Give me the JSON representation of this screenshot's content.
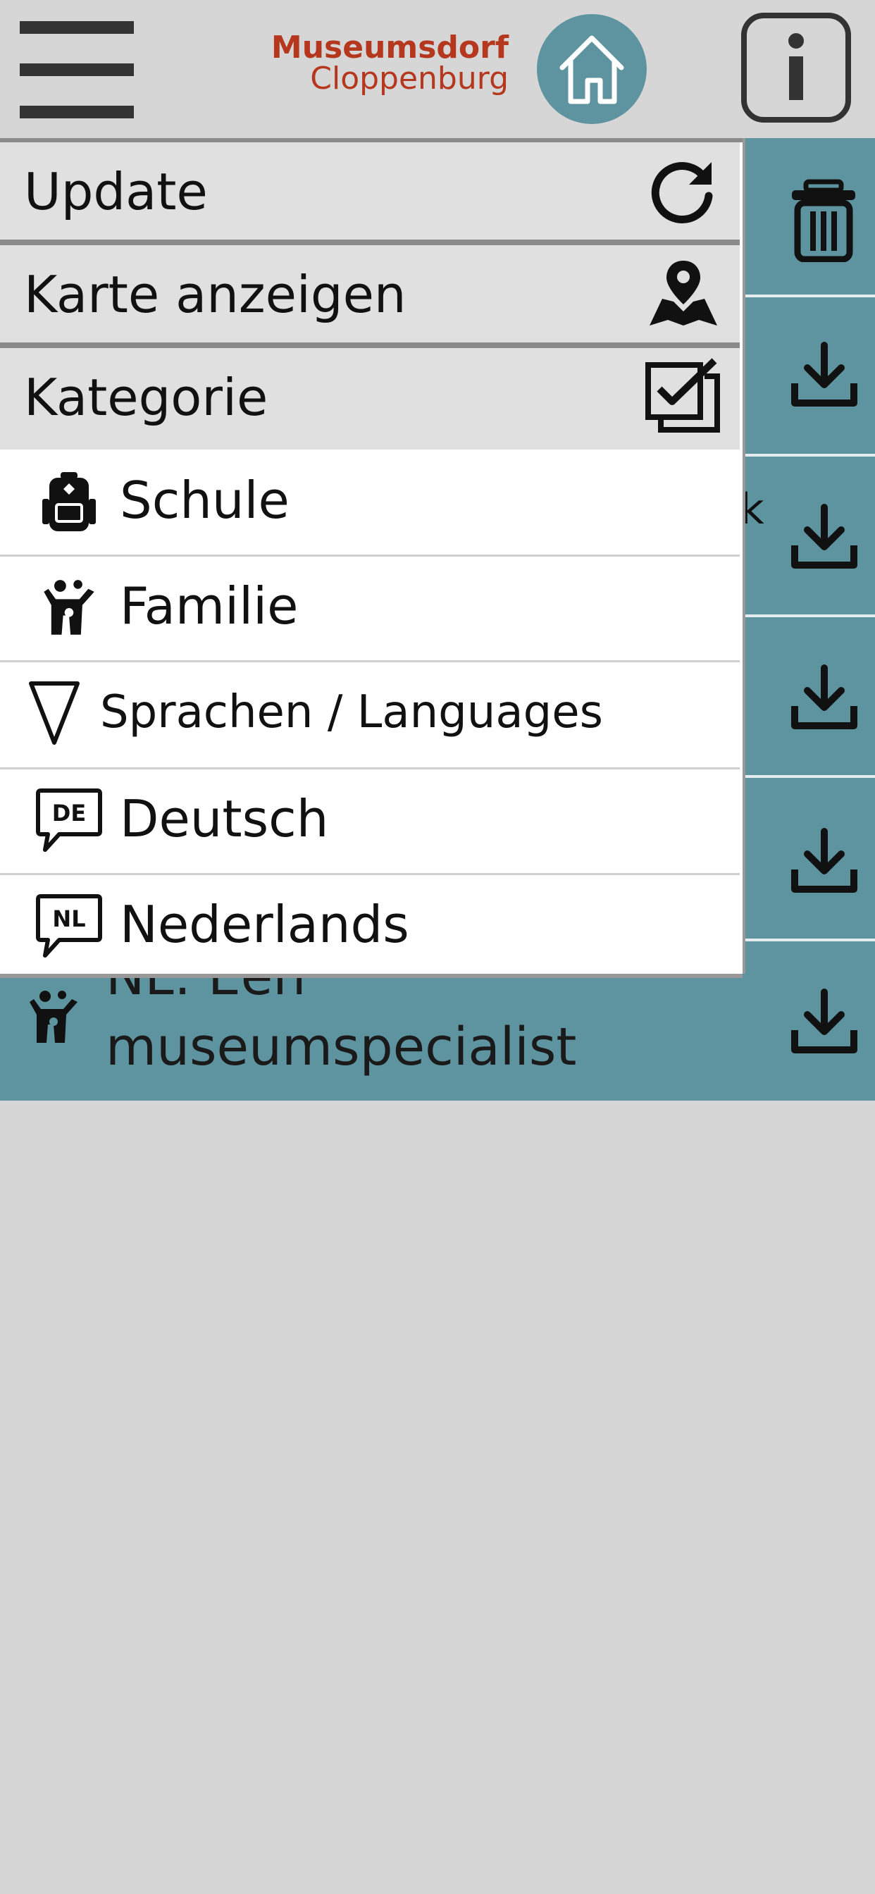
{
  "header": {
    "menu_icon": "hamburger-menu-icon",
    "logo_line1": "Museumsdorf",
    "logo_line2": "Cloppenburg",
    "home_icon": "home-icon",
    "info_icon": "info-icon"
  },
  "menu": {
    "update_label": "Update",
    "update_icon": "refresh-icon",
    "map_label": "Karte anzeigen",
    "map_icon": "map-pin-icon",
    "category_label": "Kategorie",
    "category_icon": "checkbox-icon",
    "items": [
      {
        "label": "Schule",
        "icon": "backpack-icon"
      },
      {
        "label": "Familie",
        "icon": "family-icon"
      },
      {
        "label": "Sprachen / Languages",
        "icon": "triangle-down-icon"
      },
      {
        "label": "Deutsch",
        "icon": "de-speech-bubble-icon"
      },
      {
        "label": "Nederlands",
        "icon": "nl-speech-bubble-icon"
      }
    ]
  },
  "list": {
    "last_item_line1": "NL: Een",
    "last_item_line2": "museumspecialist",
    "fragment_char": "k"
  },
  "colors": {
    "accent": "#5e94a0",
    "logo": "#b5371e",
    "background": "#d6d6d6"
  }
}
